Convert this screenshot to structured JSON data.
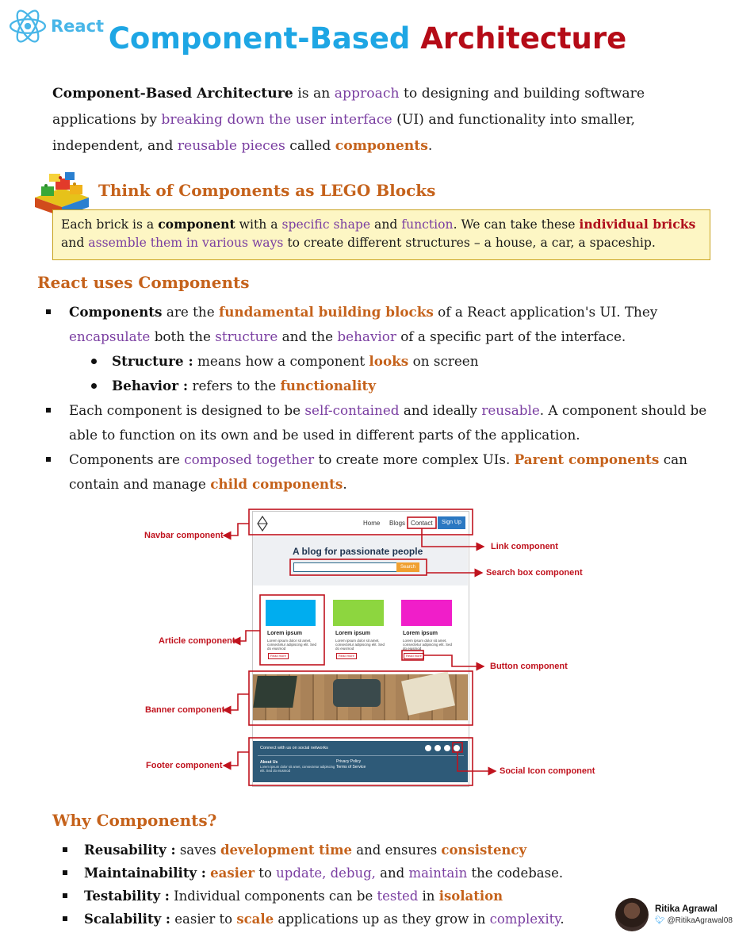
{
  "header": {
    "logo_text": "React",
    "title_part1": "Component-Based",
    "title_part2": "Architecture"
  },
  "intro": {
    "p1": "Component-Based Architecture",
    "p2": " is an ",
    "p3": "approach",
    "p4": " to designing and building software applications by ",
    "p5": "breaking down the user interface",
    "p6": " (UI) and functionality into smaller, independent, and ",
    "p7": "reusable pieces",
    "p8": " called ",
    "p9": "components",
    "p10": "."
  },
  "lego": {
    "title": "Think of Components as LEGO Blocks",
    "s1": "Each brick is a ",
    "s2": "component",
    "s3": " with a ",
    "s4": "specific shape",
    "s5": " and ",
    "s6": "function",
    "s7": ". We can take these ",
    "s8": "individual bricks",
    "s9": " and ",
    "s10": "assemble them in various ways",
    "s11": " to create different structures – a house, a car, a spaceship."
  },
  "react_section": {
    "heading": "React uses Components",
    "b1": {
      "s1": "Components",
      "s2": " are the ",
      "s3": "fundamental building blocks",
      "s4": " of a React application's UI. They ",
      "s5": "encapsulate",
      "s6": " both the ",
      "s7": "structure",
      "s8": " and the ",
      "s9": "behavior",
      "s10": " of a specific part of the interface."
    },
    "sub1": {
      "label": "Structure :",
      "s1": " means how a component ",
      "s2": "looks",
      "s3": " on screen"
    },
    "sub2": {
      "label": "Behavior :",
      "s1": " refers to the ",
      "s2": "functionality"
    },
    "b2": {
      "s1": "Each component is designed to be ",
      "s2": "self-contained",
      "s3": " and ideally ",
      "s4": "reusable",
      "s5": ". A component should be able to function on its own and be used in different parts of the application."
    },
    "b3": {
      "s1": "Components are ",
      "s2": "composed together",
      "s3": " to create more complex UIs. ",
      "s4": "Parent components",
      "s5": " can contain and manage ",
      "s6": "child components",
      "s7": "."
    }
  },
  "diagram": {
    "labels": {
      "navbar": "Navbar component",
      "link": "Link component",
      "search": "Search box component",
      "article": "Article component",
      "button": "Button component",
      "banner": "Banner component",
      "footer": "Footer component",
      "social": "Social Icon component"
    },
    "mock": {
      "nav": [
        "Home",
        "Blogs",
        "Contact"
      ],
      "signup": "Sign Up",
      "hero": "A blog for passionate people",
      "search_btn": "Search",
      "article_title": "Lorem ipsum",
      "article_body": "Lorem ipsum dolor sit amet, consectetur adipiscing elit. Sed do eiusmod",
      "read_more": "Read more",
      "footer_connect": "Connect with us on social networks",
      "footer_about": "About Us",
      "footer_about_body": "Lorem ipsum dolor sit amet, consectetur adipiscing elit. Sed do eiusmod",
      "footer_privacy": "Privacy Policy",
      "footer_terms": "Terms of Service"
    },
    "colors": {
      "annotation": "#c0131e",
      "article1": "#00adef",
      "article2": "#8dd63f",
      "article3": "#f01ec9",
      "footer": "#2e5a78",
      "signup": "#2b78c2",
      "search": "#f0a030"
    }
  },
  "why": {
    "heading": "Why Components?",
    "items": [
      {
        "label": "Reusability :",
        "s1": " saves ",
        "s2": "development time",
        "s3": " and ensures ",
        "s4": "consistency",
        "s5": ""
      },
      {
        "label": "Maintainability :",
        "s1": " ",
        "s2": "easier",
        "s3": " to ",
        "s4": "update, debug,",
        "s5": " and ",
        "s6": "maintain",
        "s7": " the codebase."
      },
      {
        "label": "Testability :",
        "s1": " Individual components can be ",
        "s2": "tested",
        "s3": " in ",
        "s4": "isolation"
      },
      {
        "label": "Scalability :",
        "s1": " easier to ",
        "s2": "scale",
        "s3": " applications up as they grow in ",
        "s4": "complexity",
        "s5": "."
      }
    ]
  },
  "author": {
    "name": "Ritika Agrawal",
    "handle": "@RitikaAgrawal08"
  }
}
